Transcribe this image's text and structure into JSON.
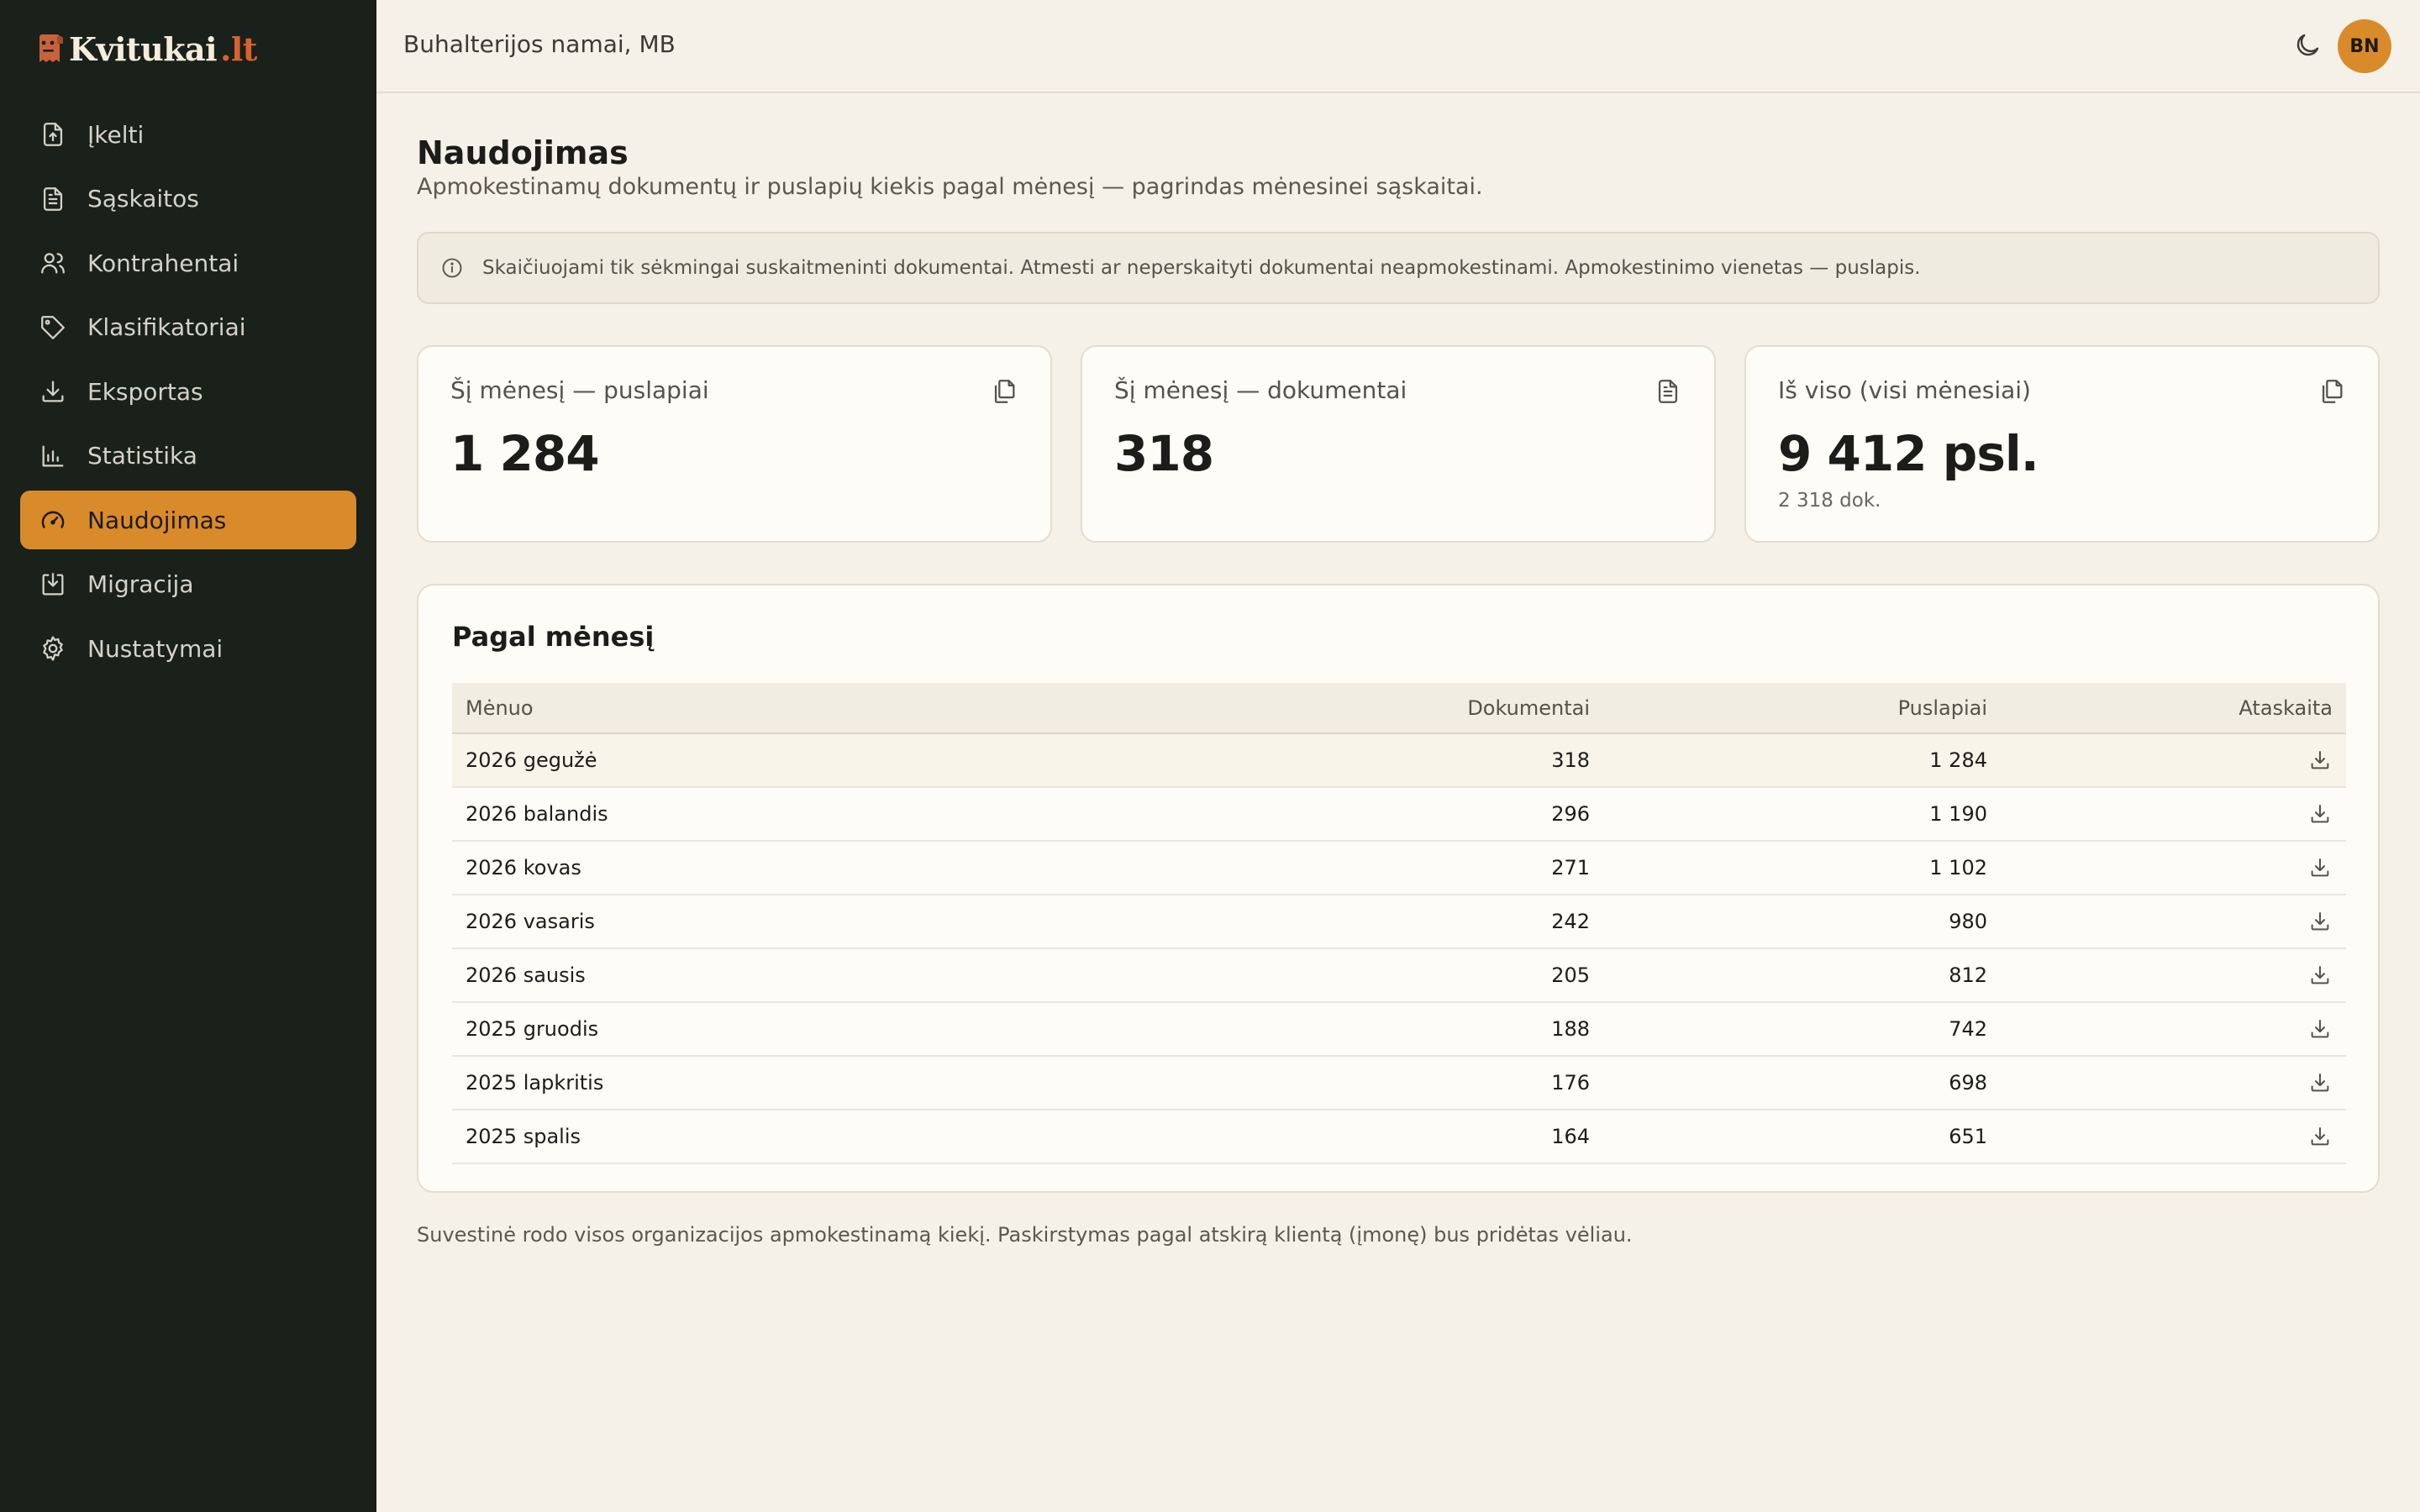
{
  "brand": {
    "name": "Kvitukai",
    "tld": ".lt",
    "accent": "#d98b2b",
    "tld_color": "#d9612f"
  },
  "sidebar": {
    "items": [
      {
        "label": "Įkelti",
        "icon": "upload-file-icon",
        "active": false
      },
      {
        "label": "Sąskaitos",
        "icon": "document-icon",
        "active": false
      },
      {
        "label": "Kontrahentai",
        "icon": "users-icon",
        "active": false
      },
      {
        "label": "Klasifikatoriai",
        "icon": "tag-icon",
        "active": false
      },
      {
        "label": "Eksportas",
        "icon": "download-icon",
        "active": false
      },
      {
        "label": "Statistika",
        "icon": "bar-chart-icon",
        "active": false
      },
      {
        "label": "Naudojimas",
        "icon": "gauge-icon",
        "active": true
      },
      {
        "label": "Migracija",
        "icon": "import-icon",
        "active": false
      },
      {
        "label": "Nustatymai",
        "icon": "gear-icon",
        "active": false
      }
    ]
  },
  "header": {
    "org_name": "Buhalterijos namai, MB",
    "theme_icon": "moon-icon",
    "avatar_initials": "BN"
  },
  "page": {
    "title": "Naudojimas",
    "subtitle": "Apmokestinamų dokumentų ir puslapių kiekis pagal mėnesį — pagrindas mėnesinei sąskaitai.",
    "info": "Skaičiuojami tik sėkmingai suskaitmeninti dokumentai. Atmesti ar neperskaityti dokumentai neapmokestinami. Apmokestinimo vienetas — puslapis.",
    "footer_note": "Suvestinė rodo visos organizacijos apmokestinamą kiekį. Paskirstymas pagal atskirą klientą (įmonę) bus pridėtas vėliau."
  },
  "stats": [
    {
      "label": "Šį mėnesį — puslapiai",
      "value": "1 284",
      "sub": "",
      "icon": "copy-pages-icon"
    },
    {
      "label": "Šį mėnesį — dokumentai",
      "value": "318",
      "sub": "",
      "icon": "document-icon"
    },
    {
      "label": "Iš viso (visi mėnesiai)",
      "value": "9 412 psl.",
      "sub": "2 318 dok.",
      "icon": "copy-pages-icon"
    }
  ],
  "monthly": {
    "title": "Pagal mėnesį",
    "columns": [
      "Mėnuo",
      "Dokumentai",
      "Puslapiai",
      "Ataskaita"
    ],
    "rows": [
      {
        "month": "2026 gegužė",
        "docs": "318",
        "pages": "1 284"
      },
      {
        "month": "2026 balandis",
        "docs": "296",
        "pages": "1 190"
      },
      {
        "month": "2026 kovas",
        "docs": "271",
        "pages": "1 102"
      },
      {
        "month": "2026 vasaris",
        "docs": "242",
        "pages": "980"
      },
      {
        "month": "2026 sausis",
        "docs": "205",
        "pages": "812"
      },
      {
        "month": "2025 gruodis",
        "docs": "188",
        "pages": "742"
      },
      {
        "month": "2025 lapkritis",
        "docs": "176",
        "pages": "698"
      },
      {
        "month": "2025 spalis",
        "docs": "164",
        "pages": "651"
      }
    ]
  }
}
